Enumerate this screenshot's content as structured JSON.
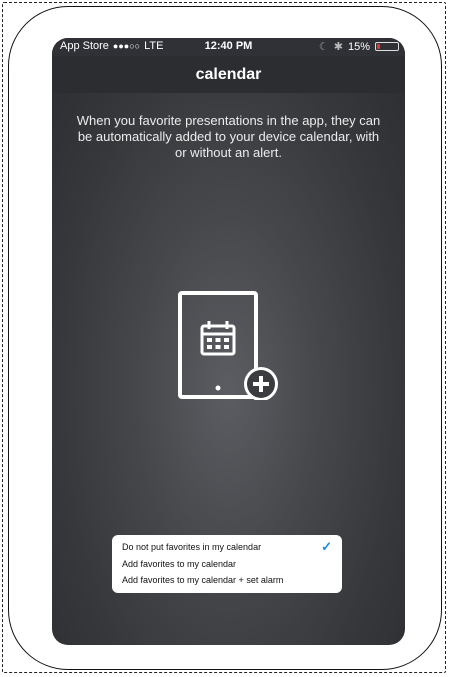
{
  "status_bar": {
    "carrier": "App Store",
    "signal": "●●●○○",
    "network": "LTE",
    "time": "12:40 PM",
    "moon_icon": "☾",
    "bluetooth_icon": "✱",
    "battery_percent": "15%",
    "battery_level": 0.15,
    "battery_color": "#e53935"
  },
  "nav": {
    "title": "calendar"
  },
  "description": "When you favorite presentations in the app, they can be automatically added to your device calendar, with or without an alert.",
  "options": [
    {
      "label": "Do not put favorites in my calendar",
      "selected": true
    },
    {
      "label": "Add favorites to my calendar",
      "selected": false
    },
    {
      "label": "Add favorites to my calendar + set alarm",
      "selected": false
    }
  ],
  "check_mark": "✓",
  "colors": {
    "accent": "#1e88e5",
    "navbar": "#2b2d31"
  }
}
